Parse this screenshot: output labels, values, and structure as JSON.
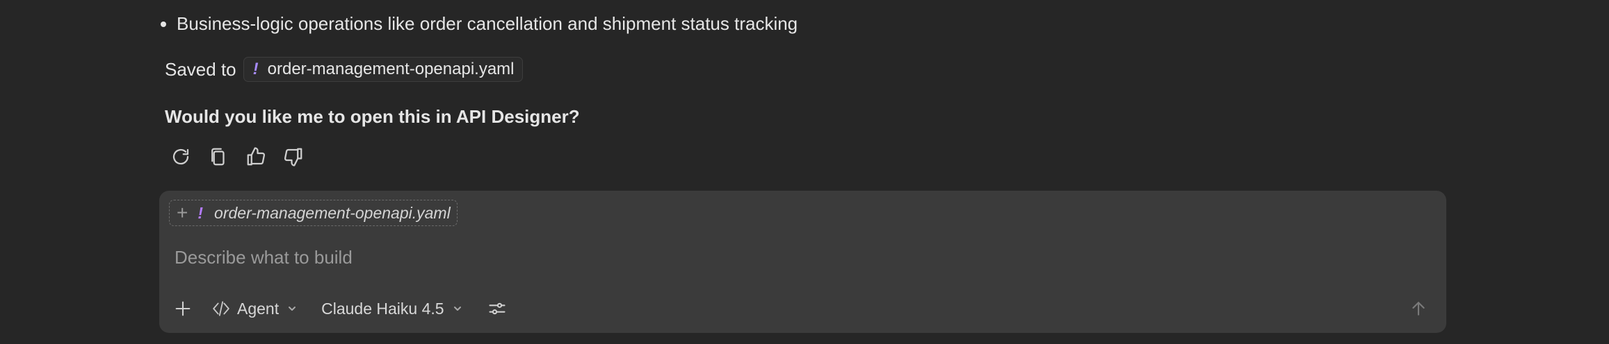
{
  "message": {
    "bullets": [
      "Business-logic operations like order cancellation and shipment status tracking"
    ],
    "saved_prefix": "Saved to",
    "saved_file": "order-management-openapi.yaml",
    "question": "Would you like me to open this in API Designer?",
    "actions": [
      "retry-icon",
      "copy-icon",
      "thumbs-up-icon",
      "thumbs-down-icon"
    ]
  },
  "composer": {
    "context_file": "order-management-openapi.yaml",
    "placeholder": "Describe what to build",
    "value": "",
    "mode_label": "Agent",
    "model_label": "Claude Haiku 4.5",
    "icons": {
      "add": "plus-icon",
      "mode": "agent-icon",
      "settings": "sliders-icon",
      "send": "arrow-up-icon"
    }
  },
  "colors": {
    "background": "#262626",
    "composer_bg": "#3b3b3b",
    "yaml_accent": "#b47cff",
    "text": "#e6e6e6",
    "placeholder": "#9a9a9a"
  }
}
